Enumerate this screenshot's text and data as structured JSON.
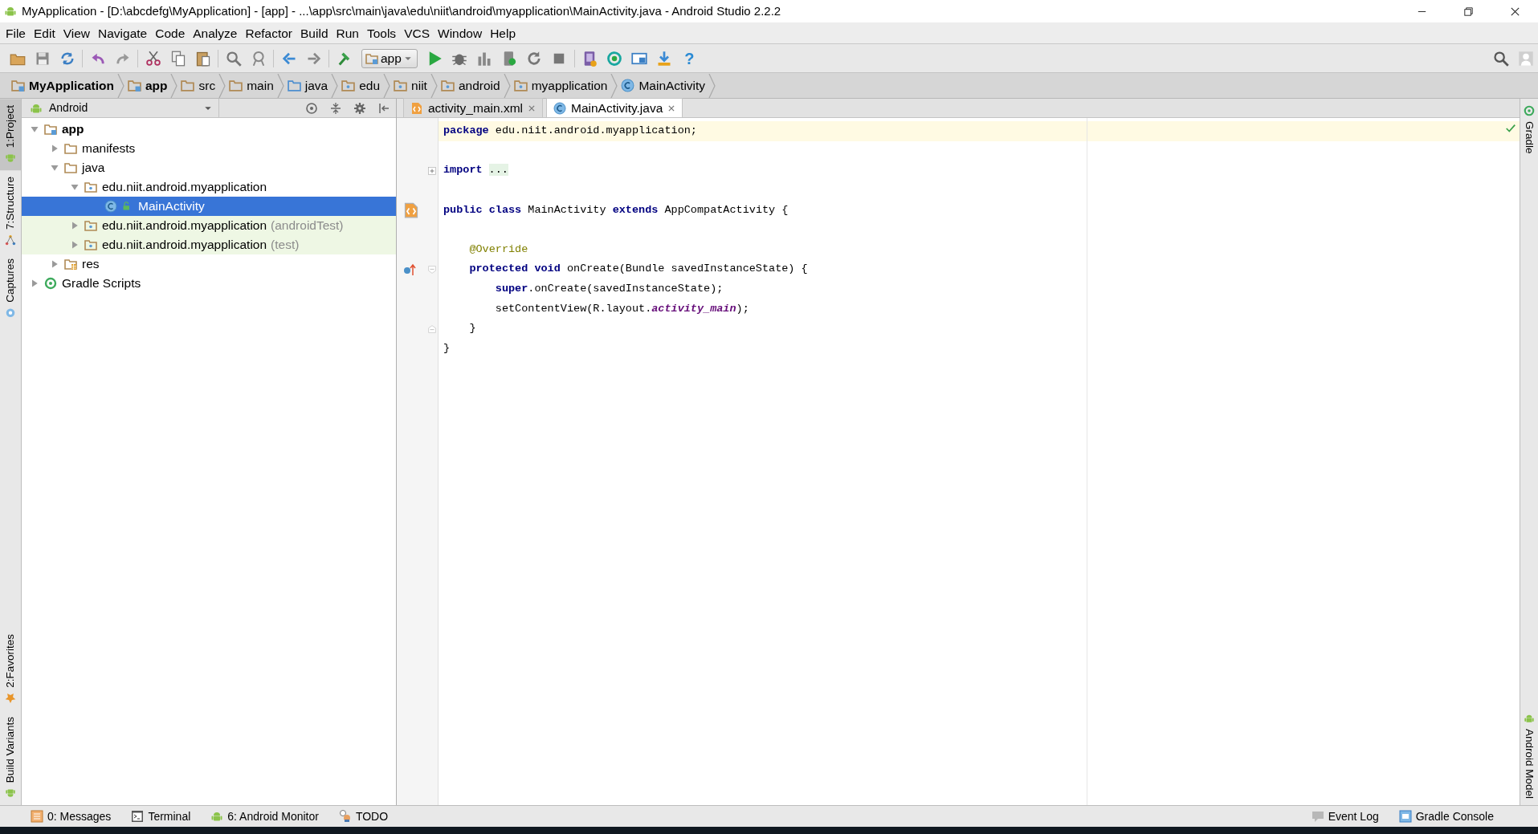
{
  "window": {
    "title": "MyApplication - [D:\\abcdefg\\MyApplication] - [app] - ...\\app\\src\\main\\java\\edu\\niit\\android\\myapplication\\MainActivity.java - Android Studio 2.2.2"
  },
  "menu": [
    "File",
    "Edit",
    "View",
    "Navigate",
    "Code",
    "Analyze",
    "Refactor",
    "Build",
    "Run",
    "Tools",
    "VCS",
    "Window",
    "Help"
  ],
  "toolbar": {
    "run_configuration": "app",
    "help_glyph": "?"
  },
  "breadcrumbs": [
    {
      "label": "MyApplication",
      "kind": "project"
    },
    {
      "label": "app",
      "kind": "module"
    },
    {
      "label": "src",
      "kind": "folder"
    },
    {
      "label": "main",
      "kind": "folder"
    },
    {
      "label": "java",
      "kind": "source"
    },
    {
      "label": "edu",
      "kind": "package"
    },
    {
      "label": "niit",
      "kind": "package"
    },
    {
      "label": "android",
      "kind": "package"
    },
    {
      "label": "myapplication",
      "kind": "package"
    },
    {
      "label": "MainActivity",
      "kind": "class"
    }
  ],
  "left_tool_tabs": {
    "top": [
      {
        "label": "1:Project",
        "selected": true
      },
      {
        "label": "7:Structure",
        "selected": false
      },
      {
        "label": "Captures",
        "selected": false
      }
    ],
    "bottom": [
      {
        "label": "2:Favorites",
        "selected": false
      },
      {
        "label": "Build Variants",
        "selected": false
      }
    ]
  },
  "right_tool_tabs": {
    "top": [
      {
        "label": "Gradle",
        "selected": false
      }
    ],
    "bottom": [
      {
        "label": "Android Model",
        "selected": false
      }
    ]
  },
  "project_panel": {
    "view": "Android",
    "tree": [
      {
        "label": "app",
        "kind": "module",
        "expanded": true,
        "selected": false,
        "children": [
          {
            "label": "manifests",
            "kind": "folder",
            "expanded": false,
            "selected": false
          },
          {
            "label": "java",
            "kind": "folder",
            "expanded": true,
            "selected": false,
            "children": [
              {
                "label": "edu.niit.android.myapplication",
                "kind": "package",
                "expanded": true,
                "selected": false,
                "children": [
                  {
                    "label": "MainActivity",
                    "kind": "class",
                    "selected": true
                  }
                ]
              },
              {
                "label": "edu.niit.android.myapplication",
                "suffix": "(androidTest)",
                "test": true,
                "kind": "package",
                "expanded": false,
                "selected": false
              },
              {
                "label": "edu.niit.android.myapplication",
                "suffix": "(test)",
                "test": true,
                "kind": "package",
                "expanded": false,
                "selected": false
              }
            ]
          },
          {
            "label": "res",
            "kind": "res",
            "expanded": false,
            "selected": false
          }
        ]
      },
      {
        "label": "Gradle Scripts",
        "kind": "gradle",
        "expanded": false,
        "selected": false
      }
    ]
  },
  "editor_tabs": [
    {
      "label": "activity_main.xml",
      "kind": "xml",
      "selected": false
    },
    {
      "label": "MainActivity.java",
      "kind": "class",
      "selected": true
    }
  ],
  "code": [
    {
      "kind": "code",
      "current": true,
      "tokens": [
        {
          "kind": "keyword",
          "text": "package"
        },
        {
          "kind": "plain",
          "text": " edu.niit.android.myapplication;"
        }
      ]
    },
    {
      "kind": "blank"
    },
    {
      "kind": "code",
      "collapsed_fold": true,
      "tokens": [
        {
          "kind": "keyword",
          "text": "import"
        },
        {
          "kind": "folded",
          "text": "..."
        }
      ]
    },
    {
      "kind": "blank"
    },
    {
      "kind": "code",
      "layout_marker": true,
      "tokens": [
        {
          "kind": "keyword",
          "text": "public class"
        },
        {
          "kind": "plain",
          "text": " MainActivity "
        },
        {
          "kind": "keyword",
          "text": "extends"
        },
        {
          "kind": "plain",
          "text": " AppCompatActivity {"
        }
      ]
    },
    {
      "kind": "blank"
    },
    {
      "kind": "code",
      "tokens": [
        {
          "kind": "annotation",
          "text": "    @Override"
        }
      ]
    },
    {
      "kind": "code",
      "override_marker": true,
      "fold_start": true,
      "tokens": [
        {
          "kind": "keyword",
          "text": "    protected void"
        },
        {
          "kind": "plain",
          "text": " onCreate(Bundle savedInstanceState) {"
        }
      ]
    },
    {
      "kind": "code",
      "tokens": [
        {
          "kind": "keyword",
          "text": "        super"
        },
        {
          "kind": "plain",
          "text": ".onCreate(savedInstanceState);"
        }
      ]
    },
    {
      "kind": "code",
      "tokens": [
        {
          "kind": "plain",
          "text": "        setContentView(R.layout."
        },
        {
          "kind": "field",
          "text": "activity_main"
        },
        {
          "kind": "plain",
          "text": ");"
        }
      ]
    },
    {
      "kind": "code",
      "fold_end": true,
      "tokens": [
        {
          "kind": "plain",
          "text": "    }"
        }
      ]
    },
    {
      "kind": "code",
      "tokens": [
        {
          "kind": "plain",
          "text": "}"
        }
      ]
    }
  ],
  "bottom_bar": {
    "left": [
      {
        "label": "0: Messages"
      },
      {
        "label": "Terminal"
      },
      {
        "label": "6: Android Monitor"
      },
      {
        "label": "TODO"
      }
    ],
    "right": [
      {
        "label": "Event Log"
      },
      {
        "label": "Gradle Console"
      }
    ]
  }
}
